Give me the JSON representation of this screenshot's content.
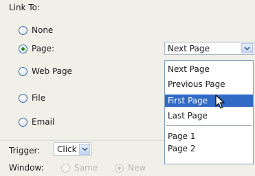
{
  "link_to": {
    "label": "Link To:",
    "options": [
      "None",
      "Page:",
      "Web Page",
      "File",
      "Email"
    ],
    "selected_index": 1
  },
  "page_select": {
    "value": "Next Page",
    "options": [
      "Next Page",
      "Previous Page",
      "First Page",
      "Last Page",
      "Page 1",
      "Page 2"
    ],
    "highlighted": "First Page"
  },
  "trigger": {
    "label": "Trigger:",
    "value": "Click"
  },
  "window": {
    "label": "Window:",
    "options": [
      "Same",
      "New"
    ]
  },
  "icons": {
    "dropdown_arrow": "chevron-down-icon",
    "cursor": "mouse-pointer-icon"
  },
  "colors": {
    "highlight": "#316ac5",
    "radio_dot": "#2b8a1f",
    "background": "#f0efe8"
  }
}
